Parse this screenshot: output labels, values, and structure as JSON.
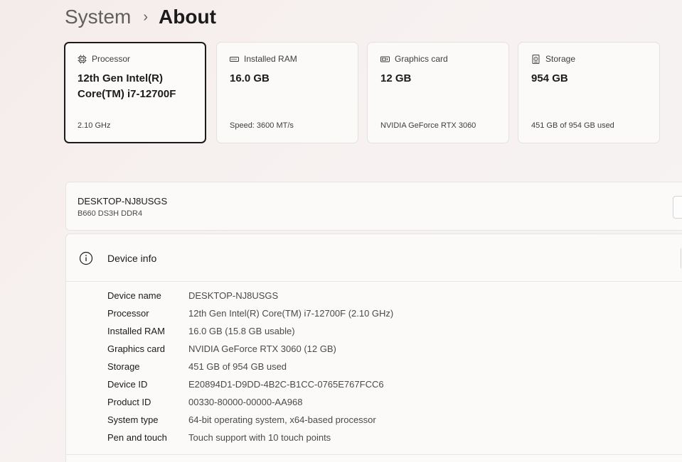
{
  "breadcrumb": {
    "parent": "System",
    "separator": "›",
    "current": "About"
  },
  "cards": [
    {
      "label": "Processor",
      "icon": "cpu-icon",
      "value": "12th Gen Intel(R) Core(TM) i7-12700F",
      "sub": "2.10 GHz"
    },
    {
      "label": "Installed RAM",
      "icon": "ram-icon",
      "value": "16.0 GB",
      "sub": "Speed: 3600 MT/s"
    },
    {
      "label": "Graphics card",
      "icon": "gpu-icon",
      "value": "12 GB",
      "sub": "NVIDIA GeForce RTX 3060"
    },
    {
      "label": "Storage",
      "icon": "storage-icon",
      "value": "954 GB",
      "sub": "451 GB of 954 GB used"
    }
  ],
  "device": {
    "name": "DESKTOP-NJ8USGS",
    "board": "B660 DS3H DDR4"
  },
  "device_info": {
    "title": "Device info",
    "rows": [
      {
        "label": "Device name",
        "value": "DESKTOP-NJ8USGS"
      },
      {
        "label": "Processor",
        "value": "12th Gen Intel(R) Core(TM) i7-12700F (2.10 GHz)"
      },
      {
        "label": "Installed RAM",
        "value": "16.0 GB (15.8 GB usable)"
      },
      {
        "label": "Graphics card",
        "value": "NVIDIA GeForce RTX 3060 (12 GB)"
      },
      {
        "label": "Storage",
        "value": "451 GB of 954 GB used"
      },
      {
        "label": "Device ID",
        "value": "E20894D1-D9DD-4B2C-B1CC-0765E767FCC6"
      },
      {
        "label": "Product ID",
        "value": "00330-80000-00000-AA968"
      },
      {
        "label": "System type",
        "value": "64-bit operating system, x64-based processor"
      },
      {
        "label": "Pen and touch",
        "value": "Touch support with 10 touch points"
      }
    ]
  }
}
